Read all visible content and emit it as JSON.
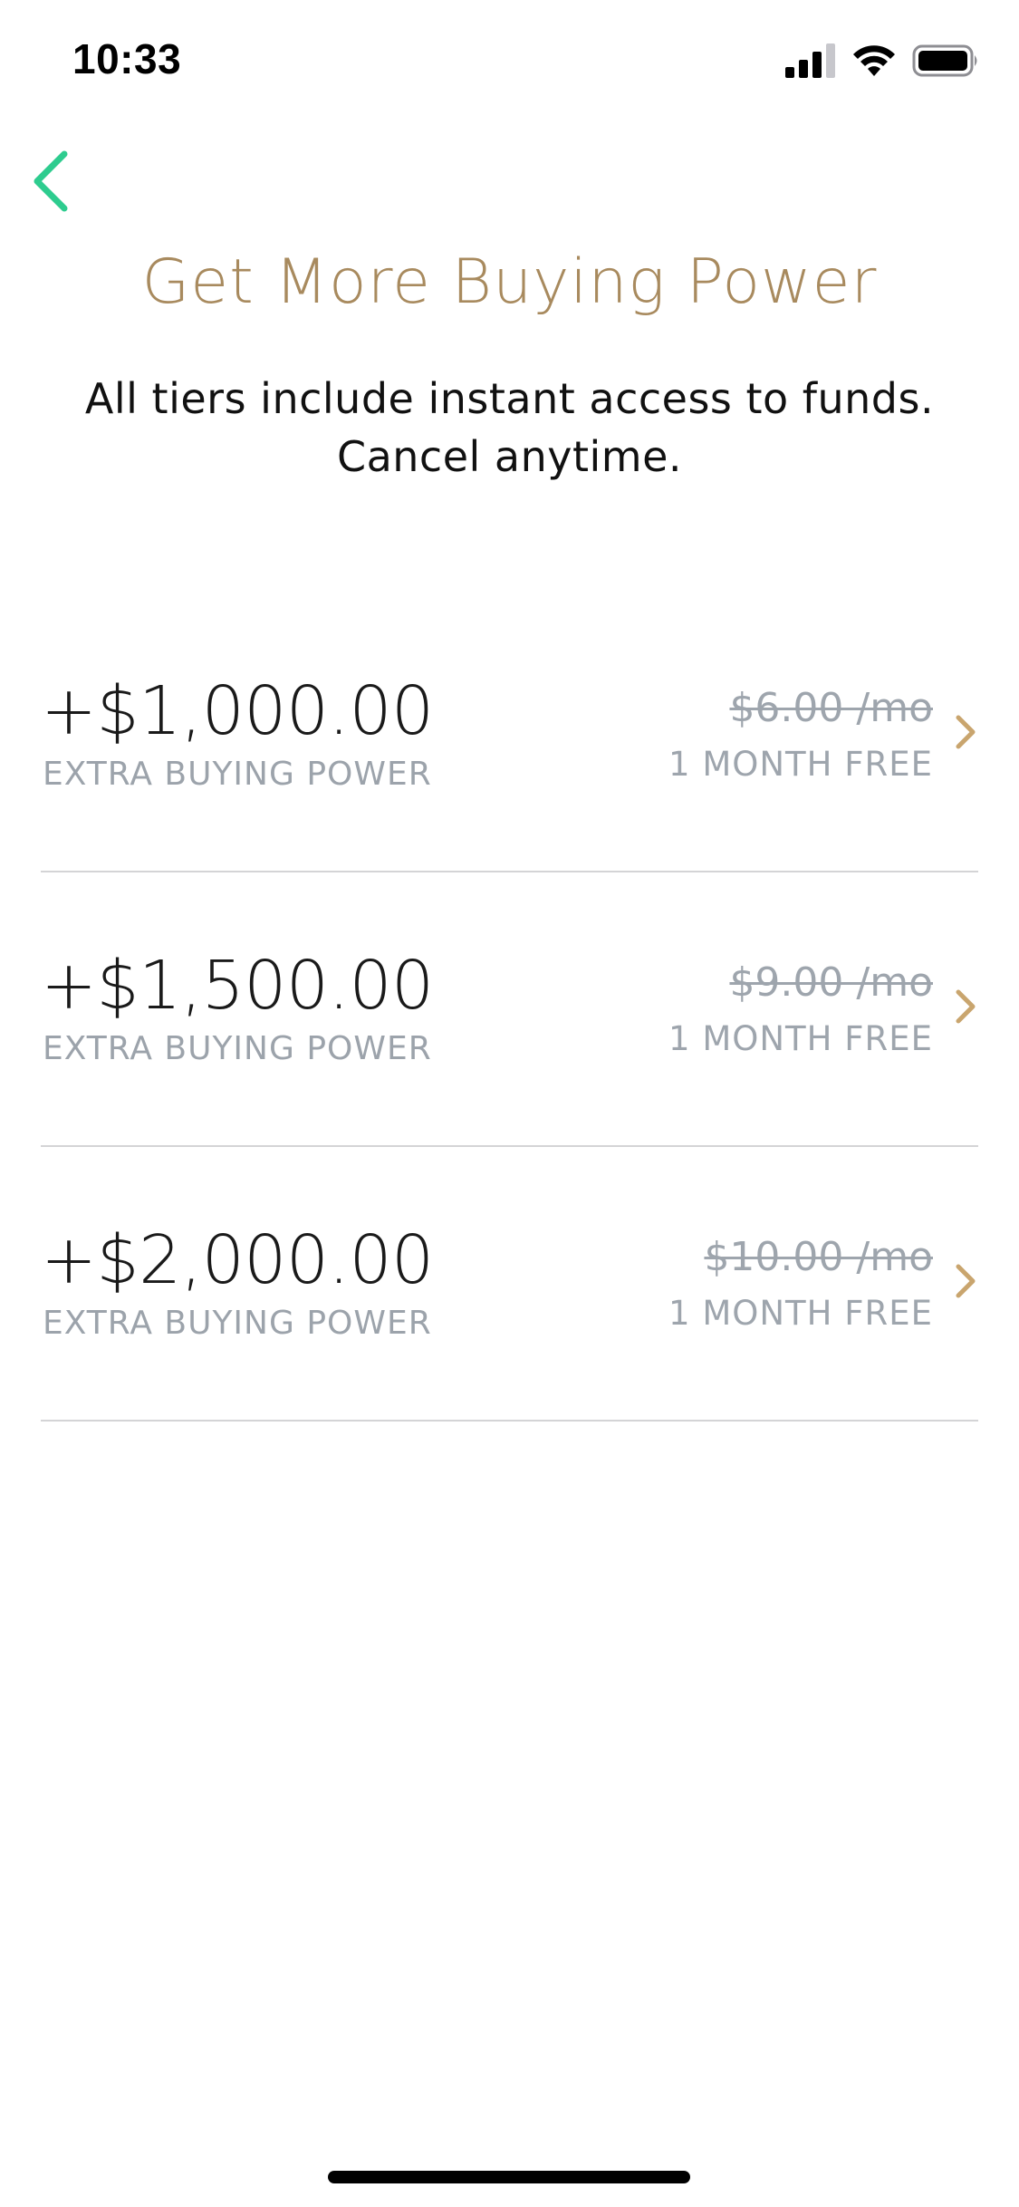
{
  "status_bar": {
    "time": "10:33",
    "icons": [
      "signal-icon",
      "wifi-icon",
      "battery-icon"
    ]
  },
  "navigation": {
    "back_icon": "chevron-left-icon",
    "back_color": "#2ecc8f"
  },
  "header": {
    "title": "Get More Buying Power",
    "subtitle_line1": "All tiers include instant access to funds.",
    "subtitle_line2": "Cancel anytime.",
    "title_color": "#a88a5e"
  },
  "tiers": [
    {
      "amount": "+$1,000.00",
      "caption": "EXTRA BUYING POWER",
      "price": "$6.00 /mo",
      "offer": "1 MONTH FREE"
    },
    {
      "amount": "+$1,500.00",
      "caption": "EXTRA BUYING POWER",
      "price": "$9.00 /mo",
      "offer": "1 MONTH FREE"
    },
    {
      "amount": "+$2,000.00",
      "caption": "EXTRA BUYING POWER",
      "price": "$10.00 /mo",
      "offer": "1 MONTH FREE"
    }
  ],
  "colors": {
    "accent_gold": "#c9a56e",
    "muted_gray": "#9ea5ad",
    "divider": "#d4d4d6"
  }
}
